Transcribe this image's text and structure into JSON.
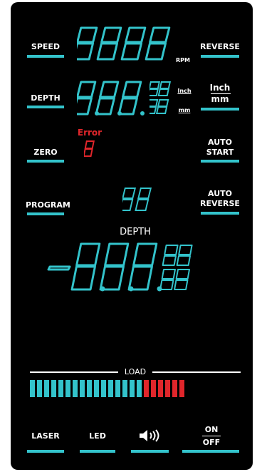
{
  "controls": {
    "speed": "SPEED",
    "reverse": "REVERSE",
    "depth": "DEPTH",
    "inch_mm_top": "Inch",
    "inch_mm_bottom": "mm",
    "zero": "ZERO",
    "auto_start_1": "AUTO",
    "auto_start_2": "START",
    "program": "PROGRAM",
    "auto_reverse_1": "AUTO",
    "auto_reverse_2": "REVERSE",
    "laser": "LASER",
    "led": "LED",
    "on": "ON",
    "off": "OFF"
  },
  "display": {
    "rpm_unit": "RPM",
    "unit_inch": "Inch",
    "unit_mm": "mm",
    "error_label": "Error",
    "depth_title": "DEPTH",
    "load_label": "LOAD",
    "load_cells_teal": 16,
    "load_cells_red": 6
  },
  "colors": {
    "accent": "#33c3cb",
    "error": "#e0262b",
    "panel": "#000000"
  }
}
